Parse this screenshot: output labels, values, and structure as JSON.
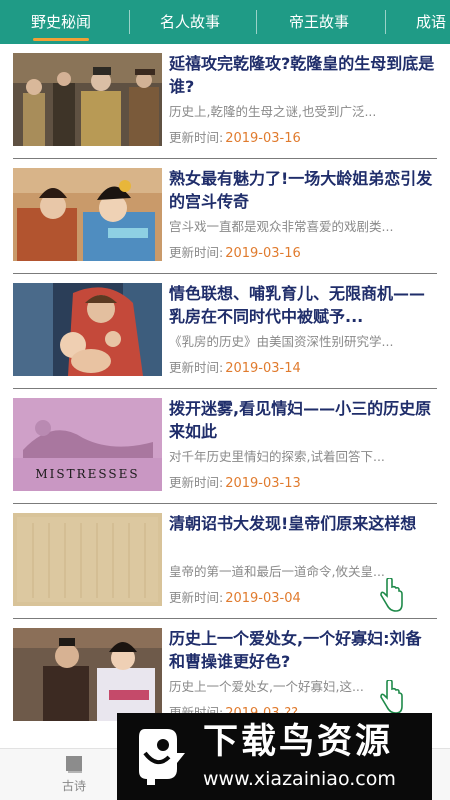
{
  "tabs": [
    {
      "label": "野史秘闻",
      "active": true
    },
    {
      "label": "名人故事",
      "active": false
    },
    {
      "label": "帝王故事",
      "active": false
    },
    {
      "label": "成语",
      "active": false
    }
  ],
  "updated_label": "更新时间:",
  "articles": [
    {
      "title": "延禧攻完乾隆攻?乾隆皇的生母到底是谁?",
      "summary": "历史上,乾隆的生母之谜,也受到广泛...",
      "date": "2019-03-16"
    },
    {
      "title": "熟女最有魅力了!一场大龄姐弟恋引发的宫斗传奇",
      "summary": "宫斗戏一直都是观众非常喜爱的戏剧类...",
      "date": "2019-03-16"
    },
    {
      "title": "情色联想、哺乳育儿、无限商机——乳房在不同时代中被赋予...",
      "summary": "《乳房的历史》由美国资深性别研究学...",
      "date": "2019-03-14"
    },
    {
      "title": "拨开迷雾,看见情妇——小三的历史原来如此",
      "summary": "对千年历史里情妇的探索,试着回答下...",
      "date": "2019-03-13"
    },
    {
      "title": "清朝诏书大发现!皇帝们原来这样想",
      "summary": "皇帝的第一道和最后一道命令,攸关皇...",
      "date": "2019-03-04"
    },
    {
      "title": "历史上一个爱处女,一个好寡妇:刘备和曹操谁更好色?",
      "summary": "历史上一个爱处女,一个好寡妇,这...",
      "date": "2019-03-??"
    }
  ],
  "thumb_book_text": "MISTRESSES",
  "bottom_nav": [
    {
      "label": "古诗",
      "icon": "book-icon"
    },
    {
      "label": "",
      "icon": "history-icon"
    },
    {
      "label": "",
      "icon": "profile-icon"
    }
  ],
  "watermark": {
    "title": "下载鸟资源",
    "url": "www.xiazainiao.com"
  },
  "colors": {
    "header": "#1f9b86",
    "tab_underline": "#f2a035",
    "title": "#1f2d6a",
    "date": "#e07b2e"
  }
}
